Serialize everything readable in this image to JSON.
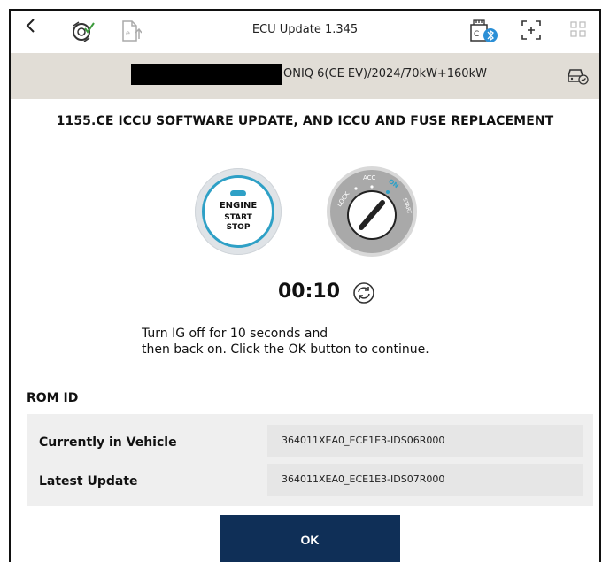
{
  "topbar": {
    "title": "ECU Update 1.345",
    "back_icon": "chevron-left-icon",
    "icons": [
      "vci-connected-icon",
      "document-upload-icon",
      "bluetooth-device-icon",
      "screen-capture-icon",
      "grid-menu-icon"
    ]
  },
  "vehicle": {
    "description": "ONIQ 6(CE EV)/2024/70kW+160kW",
    "icon": "car-check-icon"
  },
  "main": {
    "heading": "1155.CE ICCU SOFTWARE UPDATE, AND ICCU AND FUSE REPLACEMENT",
    "engine_button": {
      "line1": "ENGINE",
      "line2": "START",
      "line3": "STOP"
    },
    "ignition": {
      "lock": "LOCK",
      "acc": "ACC",
      "on": "ON",
      "start": "START"
    },
    "timer": "00:10",
    "instruction_line1": "Turn IG off for 10 seconds and",
    "instruction_line2": "then back on. Click the OK button to continue."
  },
  "rom": {
    "title": "ROM ID",
    "rows": [
      {
        "label": "Currently in Vehicle",
        "value": "364011XEA0_ECE1E3-IDS06R000"
      },
      {
        "label": "Latest Update",
        "value": "364011XEA0_ECE1E3-IDS07R000"
      }
    ]
  },
  "ok_label": "OK",
  "colors": {
    "accent_blue": "#2ea0c6",
    "ok_button": "#0f2f57",
    "vehicle_bar": "#e1ddd6"
  }
}
